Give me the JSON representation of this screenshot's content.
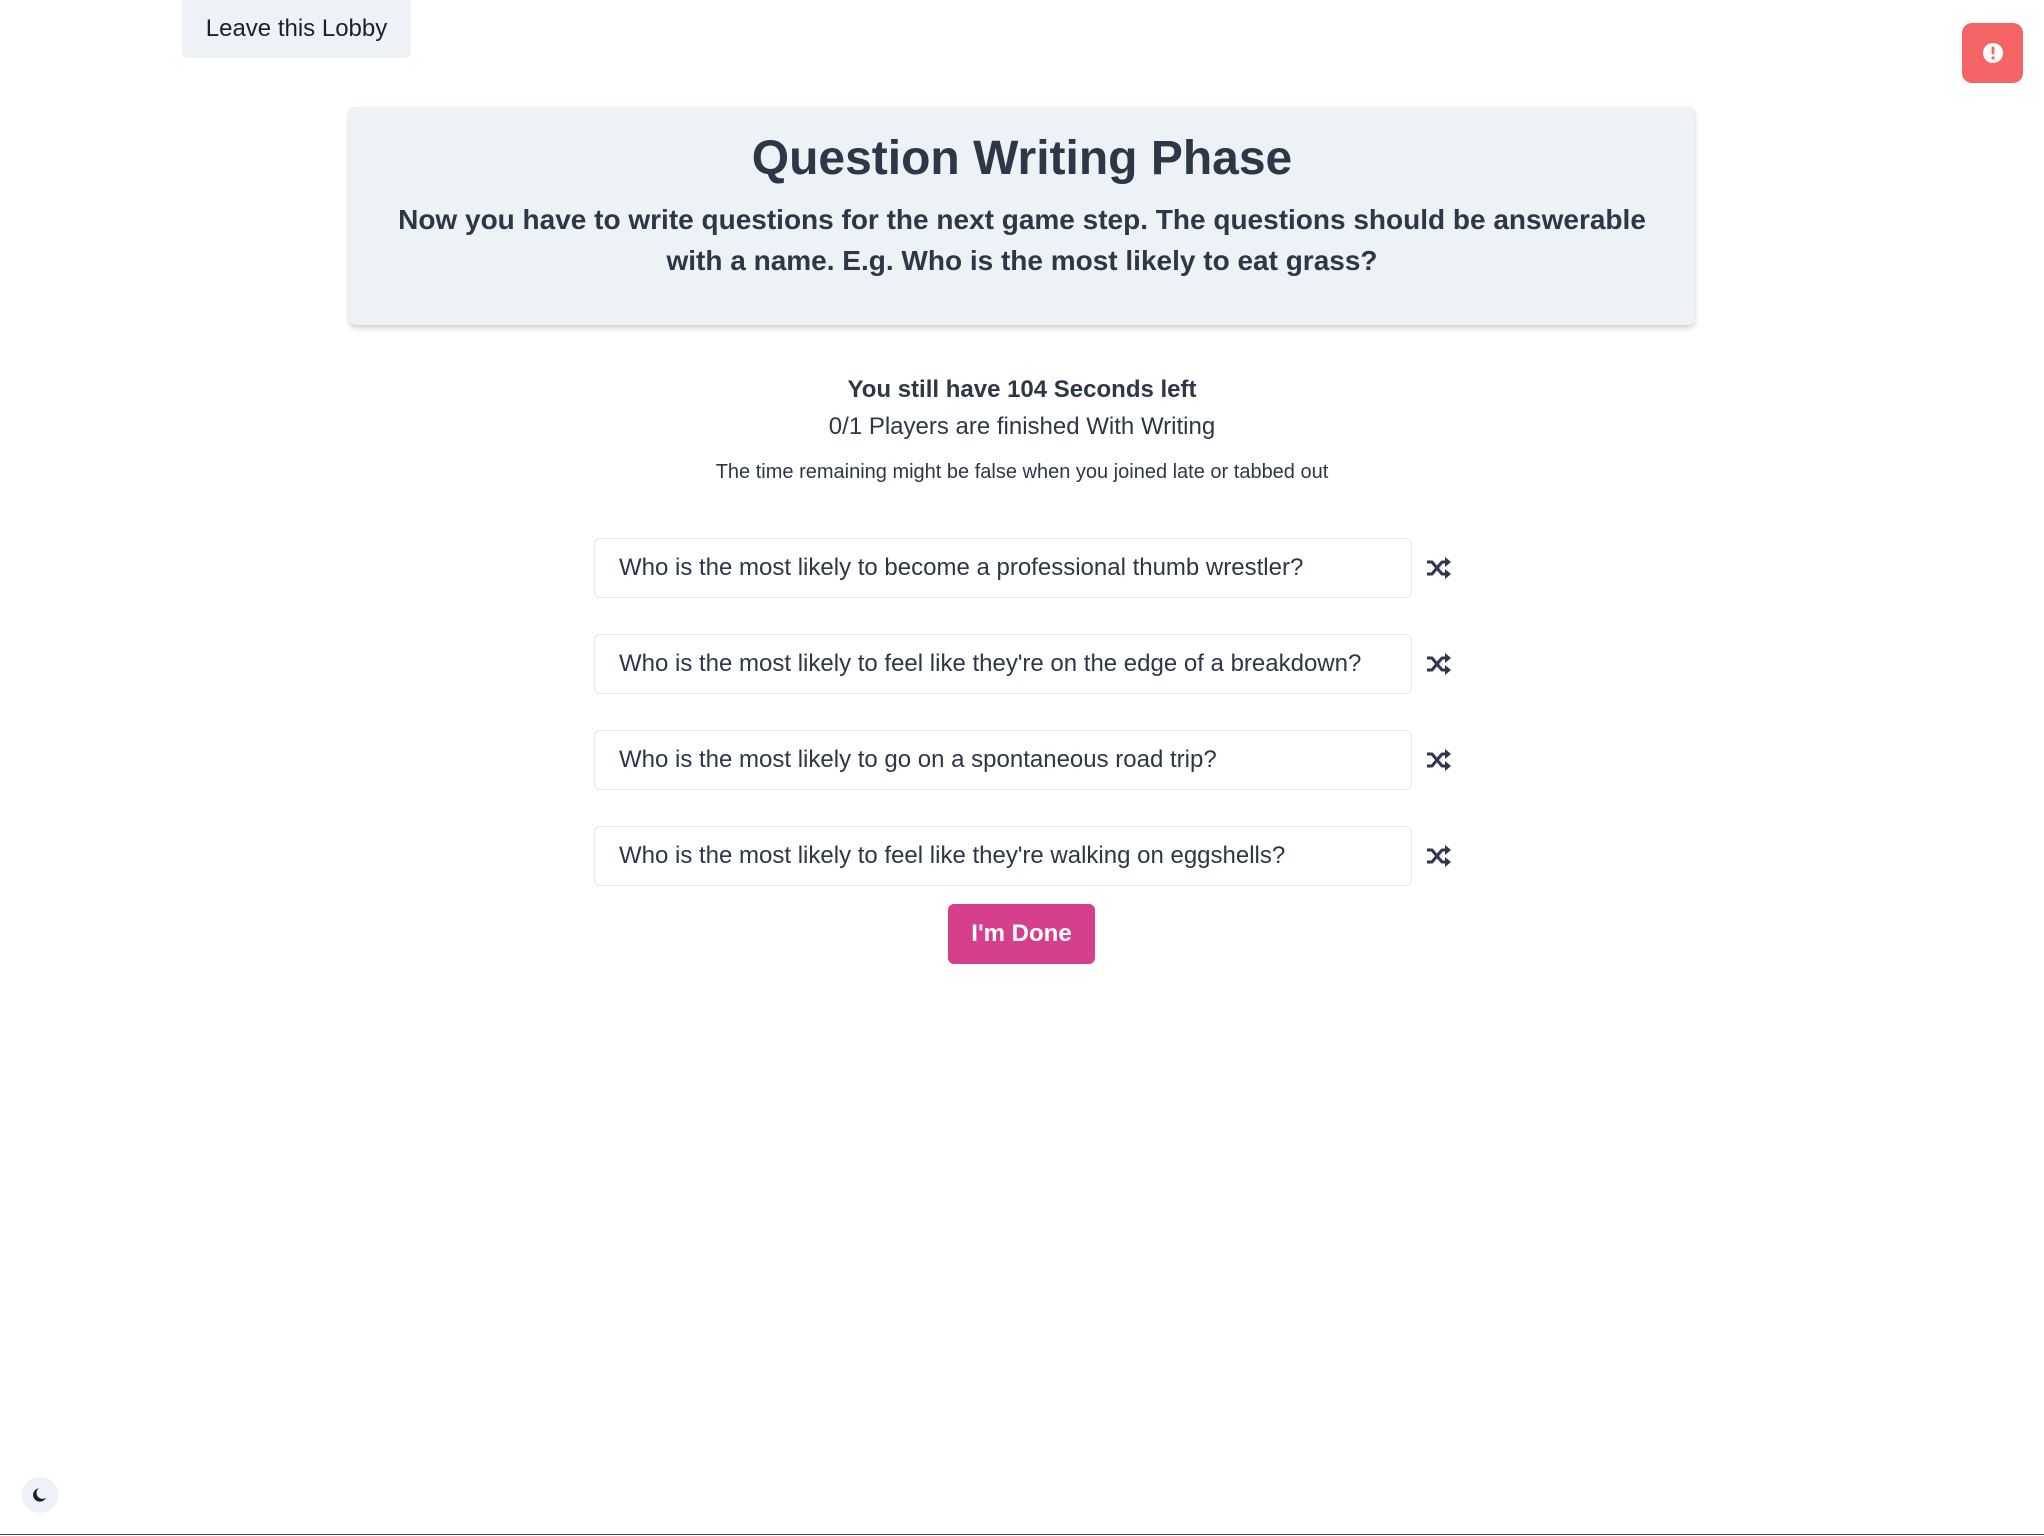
{
  "nav": {
    "leave_label": "Leave this Lobby"
  },
  "alert": {
    "icon": "exclamation-circle-icon",
    "color": "#f56565"
  },
  "header": {
    "title": "Question Writing Phase",
    "description": "Now you have to write questions for the next game step. The questions should be answerable with a name. E.g. Who is the most likely to eat grass?"
  },
  "status": {
    "time_left": "You still have 104 Seconds left",
    "players_finished": "0/1 Players are finished With Writing",
    "note": "The time remaining might be false when you joined late or tabbed out"
  },
  "questions": [
    {
      "value": "Who is the most likely to become a professional thumb wrestler?"
    },
    {
      "value": "Who is the most likely to feel like they're on the edge of a breakdown?"
    },
    {
      "value": "Who is the most likely to go on a spontaneous road trip?"
    },
    {
      "value": "Who is the most likely to feel like they're walking on eggshells?"
    }
  ],
  "actions": {
    "done_label": "I'm Done",
    "done_color": "#d53f8c"
  },
  "theme": {
    "icon": "moon-icon"
  }
}
